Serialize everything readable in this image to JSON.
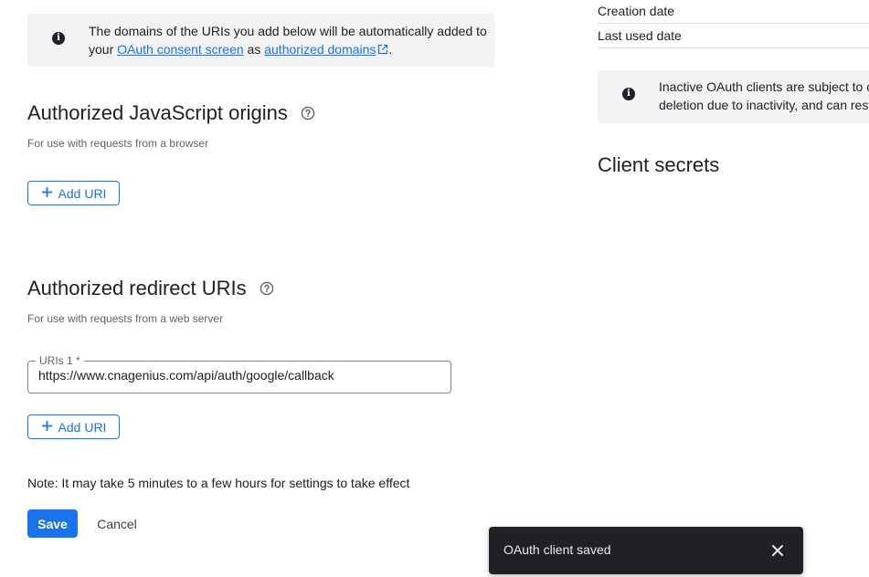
{
  "info_banner": {
    "text_before": "The domains of the URIs you add below will be automatically added to your ",
    "link1": "OAuth consent screen",
    "text_between": " as ",
    "link2": "authorized domains",
    "text_after": "."
  },
  "js_origins": {
    "title": "Authorized JavaScript origins",
    "subtitle": "For use with requests from a browser",
    "add_label": "Add URI"
  },
  "redirect_uris": {
    "title": "Authorized redirect URIs",
    "subtitle": "For use with requests from a web server",
    "field_label": "URIs 1 *",
    "field_value": "https://www.cnagenius.com/api/auth/google/callback",
    "add_label": "Add URI"
  },
  "note": "Note: It may take 5 minutes to a few hours for settings to take effect",
  "actions": {
    "save": "Save",
    "cancel": "Cancel"
  },
  "right_panel": {
    "creation_date_label": "Creation date",
    "last_used_label": "Last used date",
    "inactive_line1": "Inactive OAuth clients are subject to c",
    "inactive_line2": "deletion due to inactivity, and can rest",
    "client_secrets_title": "Client secrets"
  },
  "snackbar": {
    "message": "OAuth client saved"
  },
  "icons": {
    "info": "info-icon",
    "help": "help-circle-icon",
    "external": "external-link-icon",
    "add": "plus-icon",
    "close": "close-icon"
  },
  "colors": {
    "accent": "#1a73e8",
    "banner_bg": "#f1f3f4",
    "snackbar_bg": "#202124"
  }
}
